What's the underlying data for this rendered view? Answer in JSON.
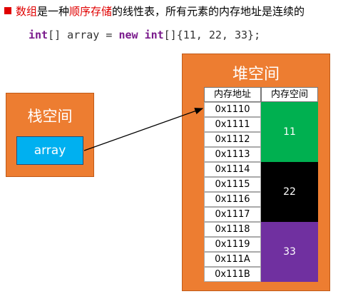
{
  "intro": {
    "prefix_red": "数组",
    "text_1": "是一种",
    "middle_red": "顺序存储",
    "text_2": "的线性表，所有元素的内存地址是连续的"
  },
  "code": {
    "kw1": "int",
    "part1": "[] array = ",
    "kw2": "new",
    "space": " ",
    "kw3": "int",
    "part2": "[]{11, 22, 33};"
  },
  "stack": {
    "label": "栈空间",
    "variable": "array"
  },
  "heap": {
    "label": "堆空间",
    "table": {
      "headers": [
        "内存地址",
        "内存空间"
      ],
      "addresses": [
        "0x1110",
        "0x1111",
        "0x1112",
        "0x1113",
        "0x1114",
        "0x1115",
        "0x1116",
        "0x1117",
        "0x1118",
        "0x1119",
        "0x111A",
        "0x111B"
      ],
      "values": [
        {
          "value": "11",
          "color": "#00b050"
        },
        {
          "value": "22",
          "color": "#000000"
        },
        {
          "value": "33",
          "color": "#7030a0"
        }
      ]
    }
  },
  "colors": {
    "box_orange": "#ed7d31",
    "variable_blue": "#00b0f0",
    "highlight_red": "#e00000"
  }
}
